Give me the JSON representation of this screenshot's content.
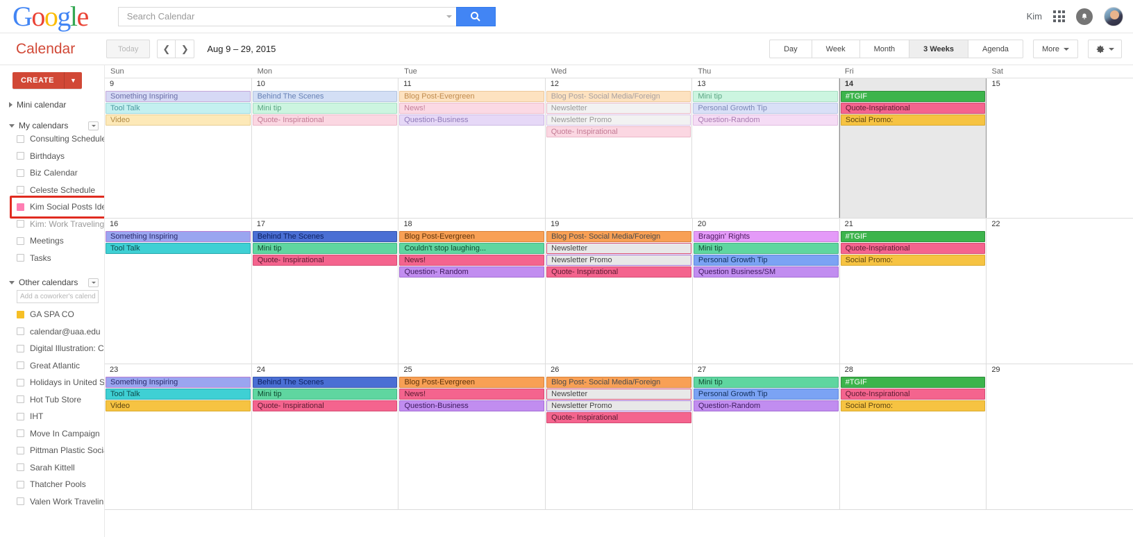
{
  "topbar": {
    "logo_letters": [
      "G",
      "o",
      "o",
      "g",
      "l",
      "e"
    ],
    "search_placeholder": "Search Calendar",
    "search_value": "",
    "search_icon": "search-icon",
    "user_name": "Kim",
    "apps_icon": "apps-grid-icon",
    "notifications_icon": "bell-icon",
    "avatar_icon": "user-avatar"
  },
  "toolbar": {
    "app_title": "Calendar",
    "today_label": "Today",
    "prev_icon": "chevron-left-icon",
    "next_icon": "chevron-right-icon",
    "date_range": "Aug 9 – 29, 2015",
    "views": [
      {
        "label": "Day",
        "active": false
      },
      {
        "label": "Week",
        "active": false
      },
      {
        "label": "Month",
        "active": false
      },
      {
        "label": "3 Weeks",
        "active": true
      },
      {
        "label": "Agenda",
        "active": false
      }
    ],
    "more_label": "More",
    "gear_icon": "gear-icon"
  },
  "sidebar": {
    "create_label": "CREATE",
    "create_arrow": "▼",
    "mini_calendar_label": "Mini calendar",
    "my_calendars_label": "My calendars",
    "other_calendars_label": "Other calendars",
    "add_coworker_placeholder": "Add a coworker's calendar",
    "my_calendars": [
      {
        "label": "Consulting Schedule",
        "state": "unchecked"
      },
      {
        "label": "Birthdays",
        "state": "unchecked"
      },
      {
        "label": "Biz Calendar",
        "state": "unchecked"
      },
      {
        "label": "Celeste Schedule",
        "state": "unchecked"
      },
      {
        "label": "Kim Social Posts Ideas",
        "state": "checked-pink",
        "highlighted": true
      },
      {
        "label": "Kim: Work Traveling ...",
        "state": "unchecked",
        "muted": true
      },
      {
        "label": "Meetings",
        "state": "unchecked"
      },
      {
        "label": "Tasks",
        "state": "unchecked"
      }
    ],
    "other_calendars": [
      {
        "label": "GA SPA CO",
        "state": "checked-yellow"
      },
      {
        "label": "calendar@uaa.edu",
        "state": "unchecked"
      },
      {
        "label": "Digital Illustration: C...",
        "state": "unchecked"
      },
      {
        "label": "Great Atlantic",
        "state": "unchecked"
      },
      {
        "label": "Holidays in United St...",
        "state": "unchecked"
      },
      {
        "label": "Hot Tub Store",
        "state": "unchecked"
      },
      {
        "label": "IHT",
        "state": "unchecked"
      },
      {
        "label": "Move In Campaign",
        "state": "unchecked"
      },
      {
        "label": "Pittman Plastic Social",
        "state": "unchecked"
      },
      {
        "label": "Sarah Kittell",
        "state": "unchecked"
      },
      {
        "label": "Thatcher Pools",
        "state": "unchecked"
      },
      {
        "label": "Valen Work Travelin...",
        "state": "unchecked"
      }
    ],
    "highlight_color": "#e02b20",
    "accent_color": "#d14836"
  },
  "grid": {
    "day_names": [
      "Sun",
      "Mon",
      "Tue",
      "Wed",
      "Thu",
      "Fri",
      "Sat"
    ],
    "today_day": 14,
    "weeks": [
      {
        "days": [
          {
            "num": "9",
            "today": false,
            "events": [
              {
                "title": "Something Inspiring",
                "bg": "#d6d9f5",
                "fg": "#6b6fa8",
                "border": "#c4a8d8"
              },
              {
                "title": "Tool Talk",
                "bg": "#c4f0f0",
                "fg": "#4a9aa0",
                "border": "#9fd8d8"
              },
              {
                "title": "Video",
                "bg": "#fde9b8",
                "fg": "#b08a45",
                "border": "#e8cd92"
              }
            ]
          },
          {
            "num": "10",
            "today": false,
            "events": [
              {
                "title": "Behind The Scenes",
                "bg": "#d3dff5",
                "fg": "#6680b5",
                "border": "#b3c4e0"
              },
              {
                "title": "Mini tip",
                "bg": "#ccf5e0",
                "fg": "#5aa583",
                "border": "#a8ddc3"
              },
              {
                "title": "Quote- Inspirational",
                "bg": "#fbd7e2",
                "fg": "#c27a93",
                "border": "#eab7c7"
              }
            ]
          },
          {
            "num": "11",
            "today": false,
            "events": [
              {
                "title": "Blog Post-Evergreen",
                "bg": "#fde2c0",
                "fg": "#c08b4d",
                "border": "#ecc79a"
              },
              {
                "title": "News!",
                "bg": "#fbd9e4",
                "fg": "#c4809a",
                "border": "#ebbacb"
              },
              {
                "title": "Question-Business",
                "bg": "#e6d8f7",
                "fg": "#8f7ab8",
                "border": "#ccb8e4"
              }
            ]
          },
          {
            "num": "12",
            "today": false,
            "events": [
              {
                "title": "Blog Post- Social Media/Foreign",
                "bg": "#fde2c0",
                "fg": "#a8a0a0",
                "border": "#ecc79a"
              },
              {
                "title": "Newsletter",
                "bg": "#f2f2f2",
                "fg": "#999999",
                "border": "#eab7c7"
              },
              {
                "title": "Newsletter Promo",
                "bg": "#f2f2f2",
                "fg": "#999999",
                "border": "#d8c0e8"
              },
              {
                "title": "Quote- Inspirational",
                "bg": "#fbd7e2",
                "fg": "#c27a93",
                "border": "#eab7c7"
              }
            ]
          },
          {
            "num": "13",
            "today": false,
            "events": [
              {
                "title": "Mini tip",
                "bg": "#ccf5e0",
                "fg": "#5aa583",
                "border": "#a8ddc3"
              },
              {
                "title": "Personal Growth Tip",
                "bg": "#d9e0f7",
                "fg": "#7b88b8",
                "border": "#bac4e4"
              },
              {
                "title": "Question-Random",
                "bg": "#f5dcf5",
                "fg": "#a87ab0",
                "border": "#e0bde0"
              }
            ]
          },
          {
            "num": "14",
            "today": true,
            "events": [
              {
                "title": "#TGIF",
                "bg": "#3cb44b",
                "fg": "#ffffff",
                "border": "#2e8c3a"
              },
              {
                "title": "Quote-Inspirational",
                "bg": "#f4648e",
                "fg": "#5a1a30",
                "border": "#d44a72"
              },
              {
                "title": "Social Promo:",
                "bg": "#f6c342",
                "fg": "#5c4410",
                "border": "#d9a92c"
              }
            ]
          },
          {
            "num": "15",
            "today": false,
            "events": []
          }
        ]
      },
      {
        "days": [
          {
            "num": "16",
            "today": false,
            "events": [
              {
                "title": "Something Inspiring",
                "bg": "#9aa5f0",
                "fg": "#2a2a6a",
                "border": "#b97fd4"
              },
              {
                "title": "Tool Talk",
                "bg": "#3fd0d4",
                "fg": "#0d4a4c",
                "border": "#2aa8ac"
              }
            ]
          },
          {
            "num": "17",
            "today": false,
            "events": [
              {
                "title": "Behind The Scenes",
                "bg": "#4a6fd4",
                "fg": "#0c1f5e",
                "border": "#3655ab"
              },
              {
                "title": "Mini tip",
                "bg": "#5fd6a0",
                "fg": "#0f4a30",
                "border": "#44b383"
              },
              {
                "title": "Quote- Inspirational",
                "bg": "#f4648e",
                "fg": "#5a1a30",
                "border": "#d44a72"
              }
            ]
          },
          {
            "num": "18",
            "today": false,
            "events": [
              {
                "title": "Blog Post-Evergreen",
                "bg": "#f8a055",
                "fg": "#5c3108",
                "border": "#d8823a"
              },
              {
                "title": "Couldn't stop laughing...",
                "bg": "#5fd6a0",
                "fg": "#0f4a30",
                "border": "#44b383"
              },
              {
                "title": "News!",
                "bg": "#f4648e",
                "fg": "#5a1a30",
                "border": "#d44a72"
              },
              {
                "title": "Question- Random",
                "bg": "#c18df0",
                "fg": "#3d1a5e",
                "border": "#a46dd4"
              }
            ]
          },
          {
            "num": "19",
            "today": false,
            "events": [
              {
                "title": "Blog Post- Social Media/Foreign",
                "bg": "#f8a055",
                "fg": "#4a4a4a",
                "border": "#d8823a"
              },
              {
                "title": "Newsletter",
                "bg": "#e8e8e8",
                "fg": "#444444",
                "border": "#d44a72"
              },
              {
                "title": "Newsletter Promo",
                "bg": "#e8e8e8",
                "fg": "#444444",
                "border": "#a46dd4"
              },
              {
                "title": "Quote- Inspirational",
                "bg": "#f4648e",
                "fg": "#5a1a30",
                "border": "#d44a72"
              }
            ]
          },
          {
            "num": "20",
            "today": false,
            "events": [
              {
                "title": "Braggin' Rights",
                "bg": "#e49af8",
                "fg": "#4a1a5c",
                "border": "#c77dd8"
              },
              {
                "title": "Mini tip",
                "bg": "#5fd6a0",
                "fg": "#0f4a30",
                "border": "#44b383"
              },
              {
                "title": "Personal Growth Tip",
                "bg": "#7ba3f4",
                "fg": "#12305c",
                "border": "#5c85d8"
              },
              {
                "title": "Question Business/SM",
                "bg": "#c18df0",
                "fg": "#3d1a5e",
                "border": "#a46dd4"
              }
            ]
          },
          {
            "num": "21",
            "today": false,
            "events": [
              {
                "title": "#TGIF",
                "bg": "#3cb44b",
                "fg": "#ffffff",
                "border": "#2e8c3a"
              },
              {
                "title": "Quote-Inspirational",
                "bg": "#f4648e",
                "fg": "#5a1a30",
                "border": "#d44a72"
              },
              {
                "title": "Social Promo:",
                "bg": "#f6c342",
                "fg": "#5c4410",
                "border": "#d9a92c"
              }
            ]
          },
          {
            "num": "22",
            "today": false,
            "events": []
          }
        ]
      },
      {
        "days": [
          {
            "num": "23",
            "today": false,
            "events": [
              {
                "title": "Something Inspiring",
                "bg": "#9aa5f0",
                "fg": "#2a2a6a",
                "border": "#b97fd4"
              },
              {
                "title": "Tool Talk",
                "bg": "#3fd0d4",
                "fg": "#0d4a4c",
                "border": "#2aa8ac"
              },
              {
                "title": "Video",
                "bg": "#f6c342",
                "fg": "#5c4410",
                "border": "#d9a92c"
              }
            ]
          },
          {
            "num": "24",
            "today": false,
            "events": [
              {
                "title": "Behind The Scenes",
                "bg": "#4a6fd4",
                "fg": "#0c1f5e",
                "border": "#3655ab"
              },
              {
                "title": "Mini tip",
                "bg": "#5fd6a0",
                "fg": "#0f4a30",
                "border": "#44b383"
              },
              {
                "title": "Quote- Inspirational",
                "bg": "#f4648e",
                "fg": "#5a1a30",
                "border": "#d44a72"
              }
            ]
          },
          {
            "num": "25",
            "today": false,
            "events": [
              {
                "title": "Blog Post-Evergreen",
                "bg": "#f8a055",
                "fg": "#5c3108",
                "border": "#d8823a"
              },
              {
                "title": "News!",
                "bg": "#f4648e",
                "fg": "#5a1a30",
                "border": "#d44a72"
              },
              {
                "title": "Question-Business",
                "bg": "#c18df0",
                "fg": "#3d1a5e",
                "border": "#a46dd4"
              }
            ]
          },
          {
            "num": "26",
            "today": false,
            "events": [
              {
                "title": "Blog Post- Social Media/Foreign",
                "bg": "#f8a055",
                "fg": "#4a4a4a",
                "border": "#d8823a"
              },
              {
                "title": "Newsletter",
                "bg": "#e8e8e8",
                "fg": "#444444",
                "border": "#d44a72"
              },
              {
                "title": "Newsletter Promo",
                "bg": "#e8e8e8",
                "fg": "#444444",
                "border": "#a46dd4"
              },
              {
                "title": "Quote- Inspirational",
                "bg": "#f4648e",
                "fg": "#5a1a30",
                "border": "#d44a72"
              }
            ]
          },
          {
            "num": "27",
            "today": false,
            "events": [
              {
                "title": "Mini tip",
                "bg": "#5fd6a0",
                "fg": "#0f4a30",
                "border": "#44b383"
              },
              {
                "title": "Personal Growth Tip",
                "bg": "#7ba3f4",
                "fg": "#12305c",
                "border": "#5c85d8"
              },
              {
                "title": "Question-Random",
                "bg": "#c18df0",
                "fg": "#3d1a5e",
                "border": "#a46dd4"
              }
            ]
          },
          {
            "num": "28",
            "today": false,
            "events": [
              {
                "title": "#TGIF",
                "bg": "#3cb44b",
                "fg": "#ffffff",
                "border": "#2e8c3a"
              },
              {
                "title": "Quote-Inspirational",
                "bg": "#f4648e",
                "fg": "#5a1a30",
                "border": "#d44a72"
              },
              {
                "title": "Social Promo:",
                "bg": "#f6c342",
                "fg": "#5c4410",
                "border": "#d9a92c"
              }
            ]
          },
          {
            "num": "29",
            "today": false,
            "events": []
          }
        ]
      }
    ]
  }
}
